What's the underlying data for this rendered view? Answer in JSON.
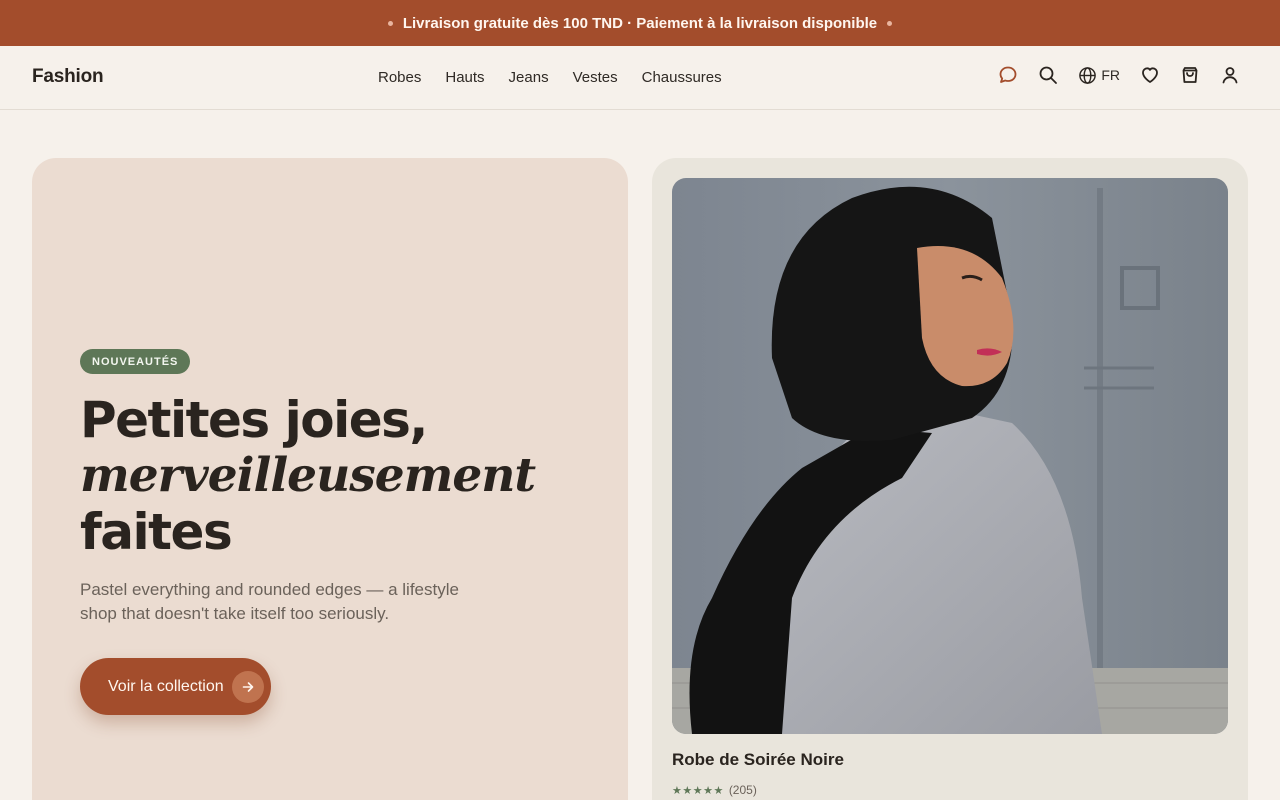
{
  "announcement": {
    "text": "Livraison gratuite dès 100 TND · Paiement à la livraison disponible"
  },
  "header": {
    "logo": "Fashion",
    "nav": [
      "Robes",
      "Hauts",
      "Jeans",
      "Vestes",
      "Chaussures"
    ],
    "lang": "FR",
    "icons": [
      "chat-icon",
      "search-icon",
      "globe-icon",
      "heart-icon",
      "bag-icon",
      "user-icon"
    ]
  },
  "hero": {
    "badge": "NOUVEAUTÉS",
    "title_line1": "Petites joies,",
    "title_line2": "merveilleusement",
    "title_line3": "faites",
    "subtitle": "Pastel everything and rounded edges — a lifestyle shop that doesn't take itself too seriously.",
    "cta_label": "Voir la collection"
  },
  "featured_product": {
    "name": "Robe de Soirée Noire",
    "stars": "★★★★★",
    "reviews": "(205)"
  },
  "colors": {
    "accent": "#a34d2c",
    "badge": "#5e7757",
    "hero_left_bg": "#ebdcd1",
    "hero_right_bg": "#e9e5dc",
    "page_bg": "#f6f1eb"
  }
}
